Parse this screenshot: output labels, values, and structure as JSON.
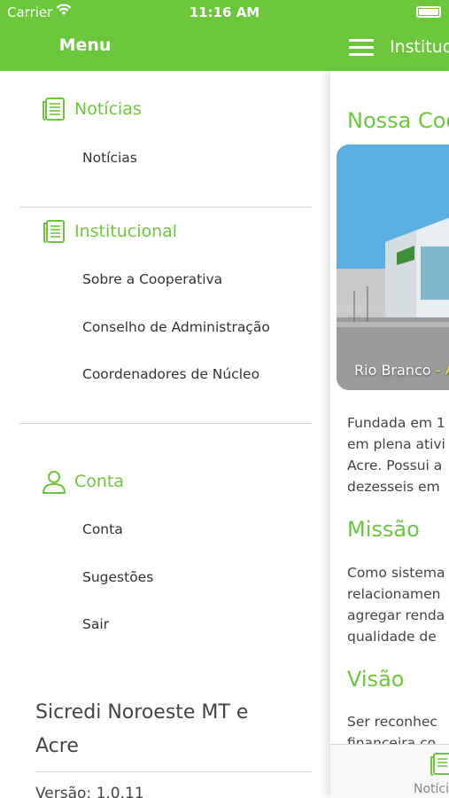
{
  "status_bar": {
    "carrier": "Carrier",
    "time": "11:16 AM"
  },
  "menu": {
    "title": "Menu",
    "sections": [
      {
        "label": "Notícias",
        "icon": "news-icon",
        "items": [
          "Notícias"
        ]
      },
      {
        "label": "Institucional",
        "icon": "book-icon",
        "items": [
          "Sobre a Cooperativa",
          "Conselho de Administração",
          "Coordenadores de Núcleo"
        ]
      },
      {
        "label": "Conta",
        "icon": "user-icon",
        "items": [
          "Conta",
          "Sugestões",
          "Sair"
        ]
      }
    ],
    "organization": "Sicredi Noroeste MT e Acre",
    "version": "Versão: 1.0.11"
  },
  "content": {
    "header_title": "Institucional",
    "page_title": "Nossa Cooperativa",
    "photo_caption_city": "Rio Branco",
    "photo_caption_sep": " - A",
    "paragraph1": [
      "Fundada em 1",
      "em plena ativi",
      "Acre. Possui a",
      "dezesseis em"
    ],
    "missao_title": "Missão",
    "paragraph2": [
      "Como sistema",
      "relacionamen",
      "agregar renda",
      "qualidade de"
    ],
    "visao_title": "Visão",
    "paragraph3": [
      "Ser reconhec",
      "financeira co"
    ],
    "tab_label": "Notícias"
  },
  "colors": {
    "accent": "#6dc73c",
    "text": "#444444"
  }
}
